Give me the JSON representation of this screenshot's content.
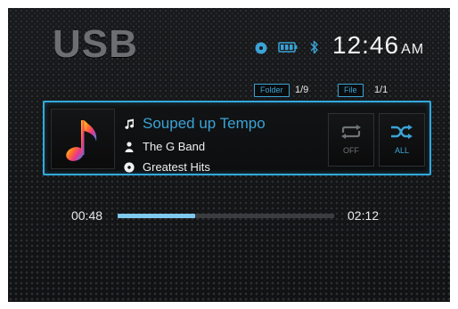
{
  "header": {
    "source": "USB",
    "status_icons": [
      "disc-icon",
      "battery-icon",
      "bluetooth-icon"
    ],
    "time": "12:46",
    "ampm": "AM"
  },
  "navigation": {
    "folder_label": "Folder",
    "folder_count": "1/9",
    "file_label": "File",
    "file_count": "1/1"
  },
  "track": {
    "title": "Souped up Tempo",
    "artist": "The G Band",
    "album": "Greatest Hits",
    "title_icon": "music-note-icon",
    "artist_icon": "person-icon",
    "album_icon": "disc-icon",
    "art_icon": "music-note-icon"
  },
  "controls": {
    "repeat": {
      "icon": "repeat-icon",
      "label": "OFF"
    },
    "shuffle": {
      "icon": "shuffle-icon",
      "label": "ALL"
    }
  },
  "playback": {
    "elapsed": "00:48",
    "total": "02:12",
    "progress": 0.36
  },
  "colors": {
    "accent": "#3ba3d6",
    "title_gray": "#6c6e72",
    "progress_fill": "#7fc9ee"
  }
}
